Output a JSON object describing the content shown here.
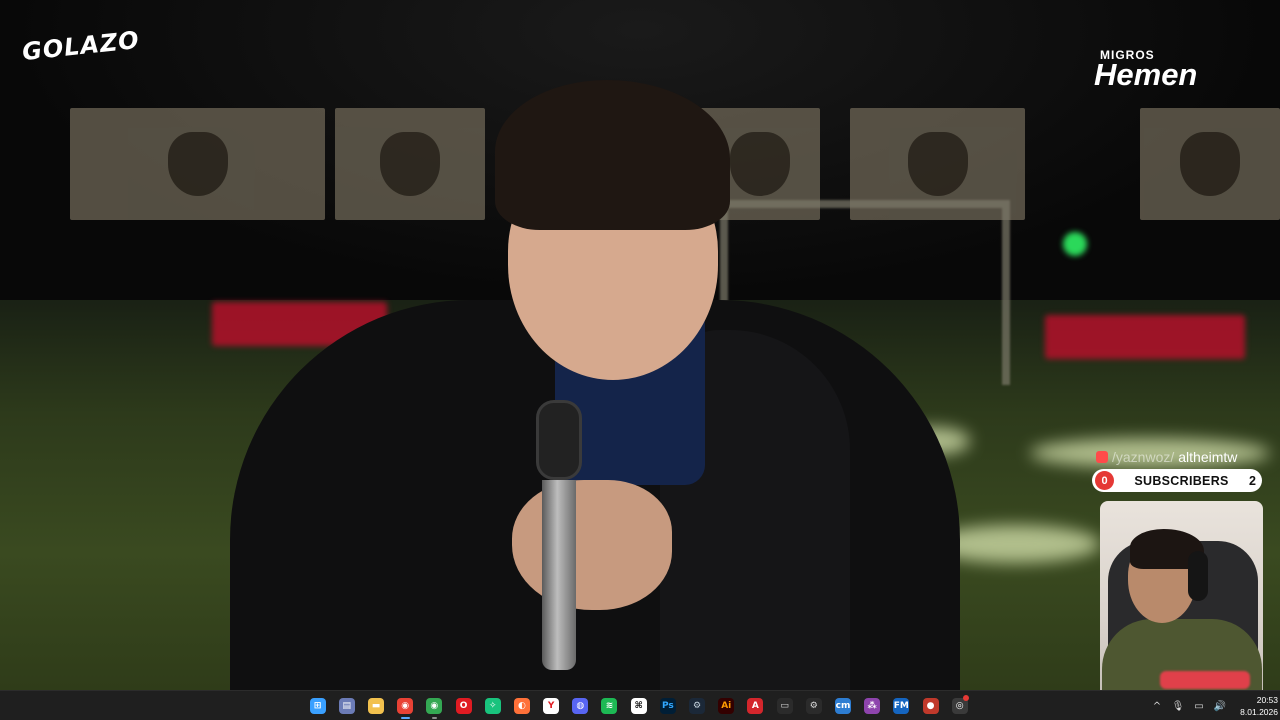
{
  "overlays": {
    "golazo_logo": "GOLAZO",
    "sponsor_small": "MIGROS",
    "sponsor_big": "Hemen",
    "social_handle_faded": "/yaznwoz/",
    "social_handle": "altheimtw",
    "subscribers": {
      "label": "SUBSCRIBERS",
      "left_count": "0",
      "right_count": "2"
    }
  },
  "taskbar": {
    "apps": [
      {
        "icon": "windows-start-icon",
        "color": "#3aa0ff",
        "glyph": "⊞"
      },
      {
        "icon": "file-explorer-alt-icon",
        "color": "#6b7bb6",
        "glyph": "▤"
      },
      {
        "icon": "folder-icon",
        "color": "#f2c14e",
        "glyph": "▬"
      },
      {
        "icon": "chrome-icon",
        "color": "#e94235",
        "glyph": "◉",
        "state": "active"
      },
      {
        "icon": "chrome-alt-icon",
        "color": "#34a853",
        "glyph": "◉",
        "state": "open"
      },
      {
        "icon": "opera-icon",
        "color": "#e01b22",
        "glyph": "O"
      },
      {
        "icon": "chatgpt-icon",
        "color": "#19c37d",
        "glyph": "✧"
      },
      {
        "icon": "firefox-icon",
        "color": "#ff7139",
        "glyph": "◐"
      },
      {
        "icon": "yandex-icon",
        "color": "#ffffff",
        "glyph": "Y",
        "fg": "#e01b22"
      },
      {
        "icon": "discord-icon",
        "color": "#5865f2",
        "glyph": "◍"
      },
      {
        "icon": "spotify-icon",
        "color": "#1db954",
        "glyph": "≋"
      },
      {
        "icon": "capcut-icon",
        "color": "#ffffff",
        "glyph": "⌘",
        "fg": "#111"
      },
      {
        "icon": "photoshop-icon",
        "color": "#001e36",
        "glyph": "Ps",
        "fg": "#31a8ff"
      },
      {
        "icon": "steam-icon",
        "color": "#1b2838",
        "glyph": "⚙",
        "fg": "#c7d5e0"
      },
      {
        "icon": "illustrator-icon",
        "color": "#330000",
        "glyph": "Ai",
        "fg": "#ff9a00"
      },
      {
        "icon": "acrobat-icon",
        "color": "#d4262c",
        "glyph": "A"
      },
      {
        "icon": "camera-icon",
        "color": "#2b2b2b",
        "glyph": "▭",
        "fg": "#ddd"
      },
      {
        "icon": "settings-icon",
        "color": "#2b2b2b",
        "glyph": "⚙",
        "fg": "#ddd"
      },
      {
        "icon": "cm-app-icon",
        "color": "#2d7dd2",
        "glyph": "cm"
      },
      {
        "icon": "purple-app-icon",
        "color": "#8e44ad",
        "glyph": "⁂"
      },
      {
        "icon": "fm-app-icon",
        "color": "#1565c0",
        "glyph": "FM"
      },
      {
        "icon": "obs-record-icon",
        "color": "#c0392b",
        "glyph": "●"
      },
      {
        "icon": "obs-icon",
        "color": "#3a3a3a",
        "glyph": "◎",
        "badge": true
      }
    ],
    "tray": [
      {
        "icon": "chevron-up-icon",
        "glyph": "^"
      },
      {
        "icon": "microphone-icon",
        "glyph": "🎙"
      },
      {
        "icon": "network-icon",
        "glyph": "▭"
      },
      {
        "icon": "volume-icon",
        "glyph": "🔊"
      }
    ],
    "time": "20:53",
    "date": "8.01.2026"
  }
}
